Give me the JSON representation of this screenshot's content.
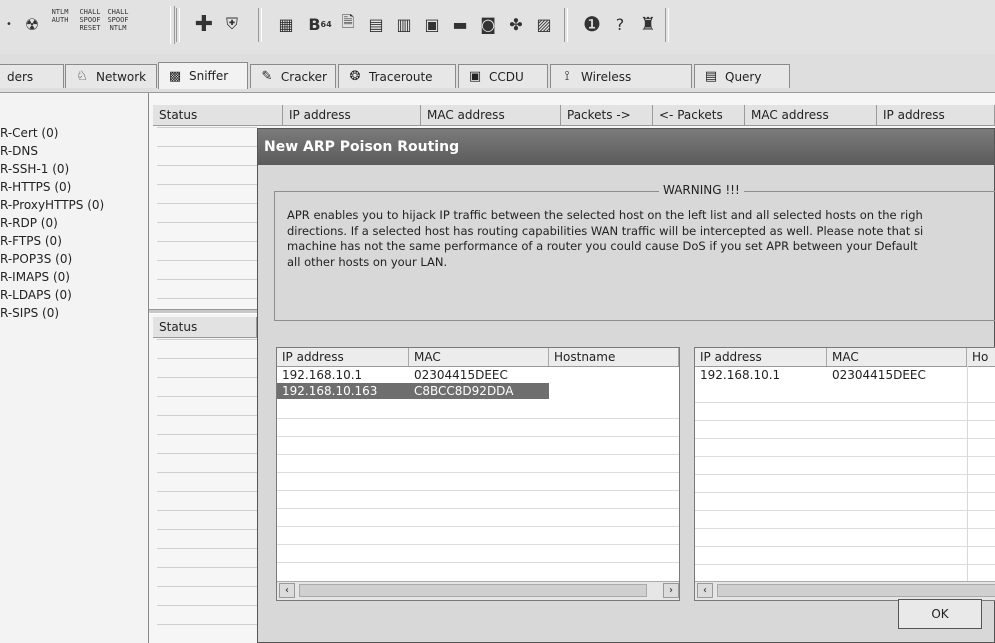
{
  "toolbar": {
    "ntlm_auth": "NTLM AUTH",
    "chall_spoof_reset": "CHALL SPOOF RESET",
    "chall_spoof_ntlm": "CHALL SPOOF NTLM",
    "base64_label": "B",
    "base64_sub": "64"
  },
  "tabs": [
    "ders",
    "Network",
    "Sniffer",
    "Cracker",
    "Traceroute",
    "CCDU",
    "Wireless",
    "Query"
  ],
  "left_list": [
    "R-Cert (0)",
    "R-DNS",
    "R-SSH-1 (0)",
    "R-HTTPS (0)",
    "R-ProxyHTTPS (0)",
    "R-RDP (0)",
    "R-FTPS (0)",
    "R-POP3S (0)",
    "R-IMAPS (0)",
    "R-LDAPS (0)",
    "R-SIPS (0)"
  ],
  "main_table": {
    "headers": [
      "Status",
      "IP address",
      "MAC address",
      "Packets ->",
      "<- Packets",
      "MAC address",
      "IP address"
    ],
    "lower_header": "Status"
  },
  "dialog": {
    "title": "New ARP Poison Routing",
    "warning_title": "WARNING !!!",
    "warning_lines": [
      "APR enables you to hijack IP traffic between the selected host on the left list and all selected hosts on the righ",
      "directions. If a selected host has routing capabilities WAN traffic will be intercepted as well. Please note that si",
      "machine has not the same performance of a router you could cause DoS if you set APR between your Default",
      "all other hosts on your LAN."
    ],
    "left_list": {
      "headers": [
        "IP address",
        "MAC",
        "Hostname"
      ],
      "rows": [
        {
          "ip": "192.168.10.1",
          "mac": "02304415DEEC",
          "host": "",
          "selected": false
        },
        {
          "ip": "192.168.10.163",
          "mac": "C8BCC8D92DDA",
          "host": "",
          "selected": true
        }
      ]
    },
    "right_list": {
      "headers": [
        "IP address",
        "MAC",
        "Ho"
      ],
      "rows": [
        {
          "ip": "192.168.10.1",
          "mac": "02304415DEEC",
          "host": ""
        }
      ]
    },
    "ok_label": "OK"
  }
}
